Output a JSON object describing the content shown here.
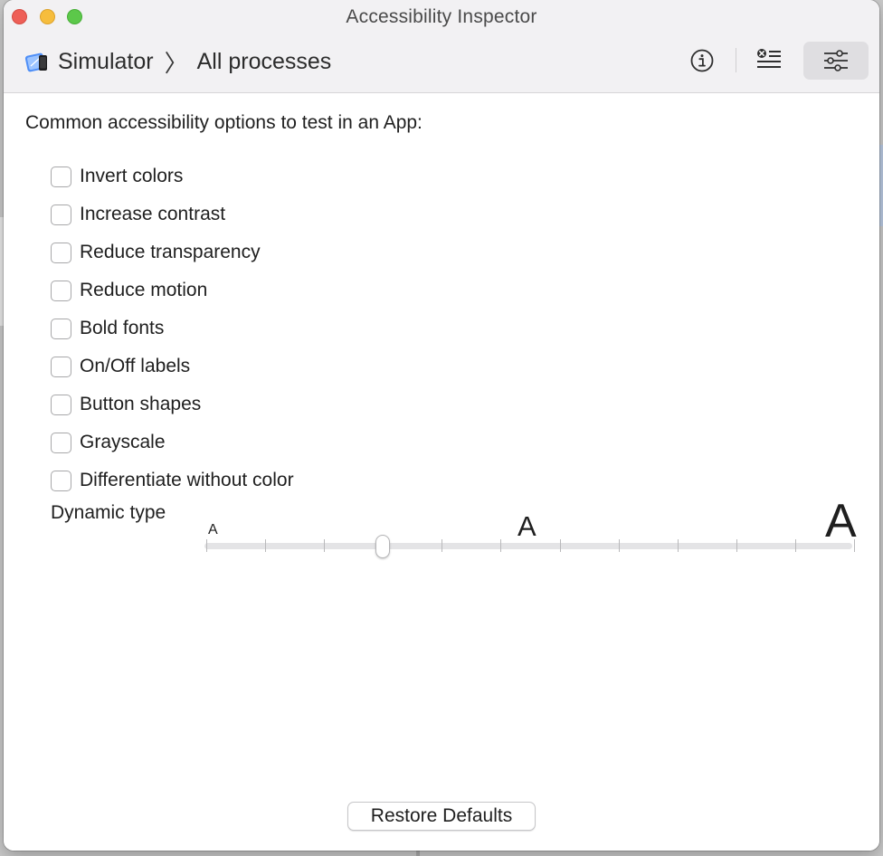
{
  "window": {
    "title": "Accessibility Inspector"
  },
  "breadcrumb": {
    "app_icon": "simulator-app-icon",
    "app_name": "Simulator",
    "separator": "〉",
    "target": "All processes"
  },
  "toolbar": {
    "buttons": [
      {
        "icon": "info-icon",
        "selected": false
      },
      {
        "icon": "audit-list-icon",
        "selected": false
      },
      {
        "icon": "sliders-icon",
        "selected": true
      }
    ]
  },
  "settings": {
    "intro": "Common accessibility options to test in an App:",
    "options": [
      {
        "label": "Invert colors",
        "checked": false
      },
      {
        "label": "Increase contrast",
        "checked": false
      },
      {
        "label": "Reduce transparency",
        "checked": false
      },
      {
        "label": "Reduce motion",
        "checked": false
      },
      {
        "label": "Bold fonts",
        "checked": false
      },
      {
        "label": "On/Off labels",
        "checked": false
      },
      {
        "label": "Button shapes",
        "checked": false
      },
      {
        "label": "Grayscale",
        "checked": false
      },
      {
        "label": "Differentiate without color",
        "checked": false
      }
    ],
    "dynamic_type": {
      "label": "Dynamic type",
      "small_marker": "A",
      "medium_marker": "A",
      "large_marker": "A",
      "steps": 12,
      "current_step": 3
    },
    "restore_label": "Restore Defaults"
  },
  "colors": {
    "close": "#ee5f57",
    "minimize": "#f6bd3d",
    "zoom": "#5cc84a",
    "titlebar": "#f2f1f3",
    "selected_tool": "#dfdee1"
  }
}
